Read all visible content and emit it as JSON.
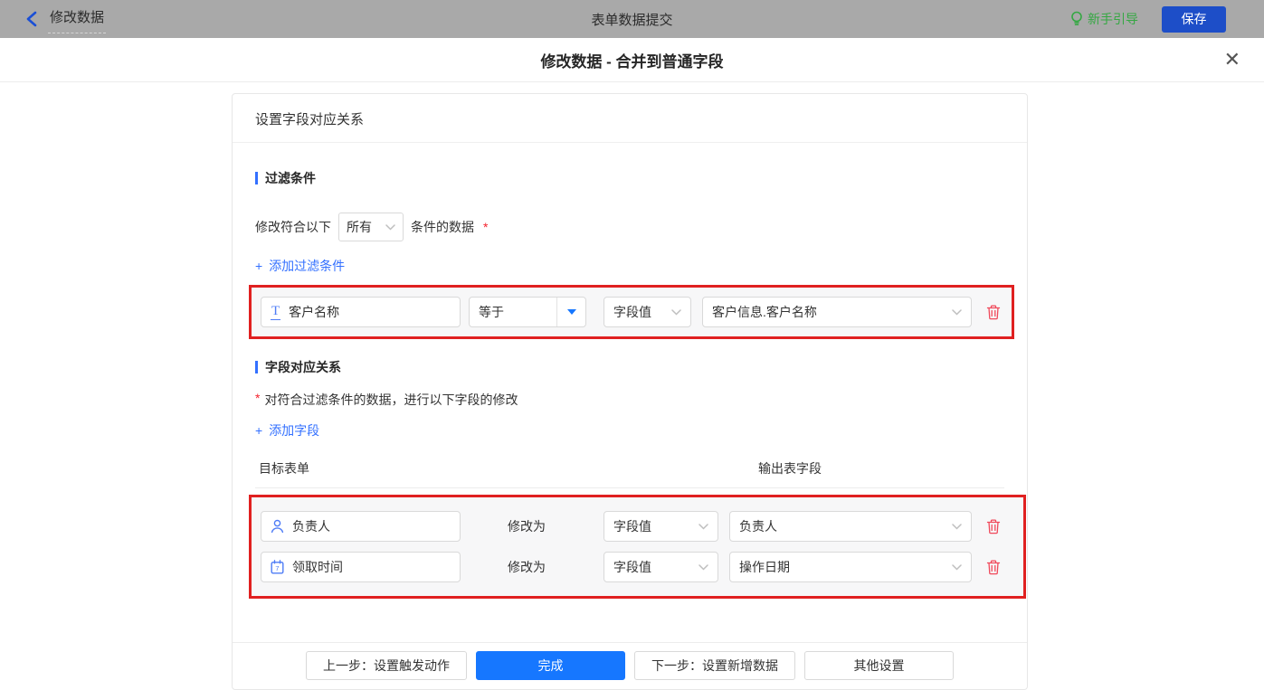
{
  "topbar": {
    "back_label": "修改数据",
    "center_title": "表单数据提交",
    "guide_label": "新手引导",
    "save_label": "保存"
  },
  "modal": {
    "title": "修改数据 - 合并到普通字段",
    "close_glyph": "✕"
  },
  "panel": {
    "header": "设置字段对应关系",
    "filter_section": {
      "title": "过滤条件",
      "match_prefix": "修改符合以下",
      "match_select_value": "所有",
      "match_suffix": "条件的数据",
      "required_mark": "*",
      "add_plus": "+",
      "add_label": "添加过滤条件",
      "condition": {
        "field": "客户名称",
        "operator": "等于",
        "value_type": "字段值",
        "value": "客户信息.客户名称"
      }
    },
    "mapping_section": {
      "title": "字段对应关系",
      "required_mark": "*",
      "description": "对符合过滤条件的数据，进行以下字段的修改",
      "add_plus": "+",
      "add_label": "添加字段",
      "col_target": "目标表单",
      "col_output": "输出表字段",
      "rows": [
        {
          "field": "负责人",
          "modify_label": "修改为",
          "value_type": "字段值",
          "value": "负责人",
          "calendar_digit": ""
        },
        {
          "field": "领取时间",
          "modify_label": "修改为",
          "value_type": "字段值",
          "value": "操作日期",
          "calendar_digit": "7"
        }
      ]
    }
  },
  "footer": {
    "prev_label": "上一步：设置触发动作",
    "done_label": "完成",
    "next_label": "下一步：设置新增数据",
    "other_label": "其他设置"
  },
  "colors": {
    "topbar_gray": "#a9a9a9",
    "accent_blue": "#3370ff",
    "save_button_blue": "#1d4ec8",
    "done_button_blue": "#1677ff",
    "guide_green": "#35a843",
    "danger_red": "#f5222d",
    "annotation_red": "#e02020"
  }
}
